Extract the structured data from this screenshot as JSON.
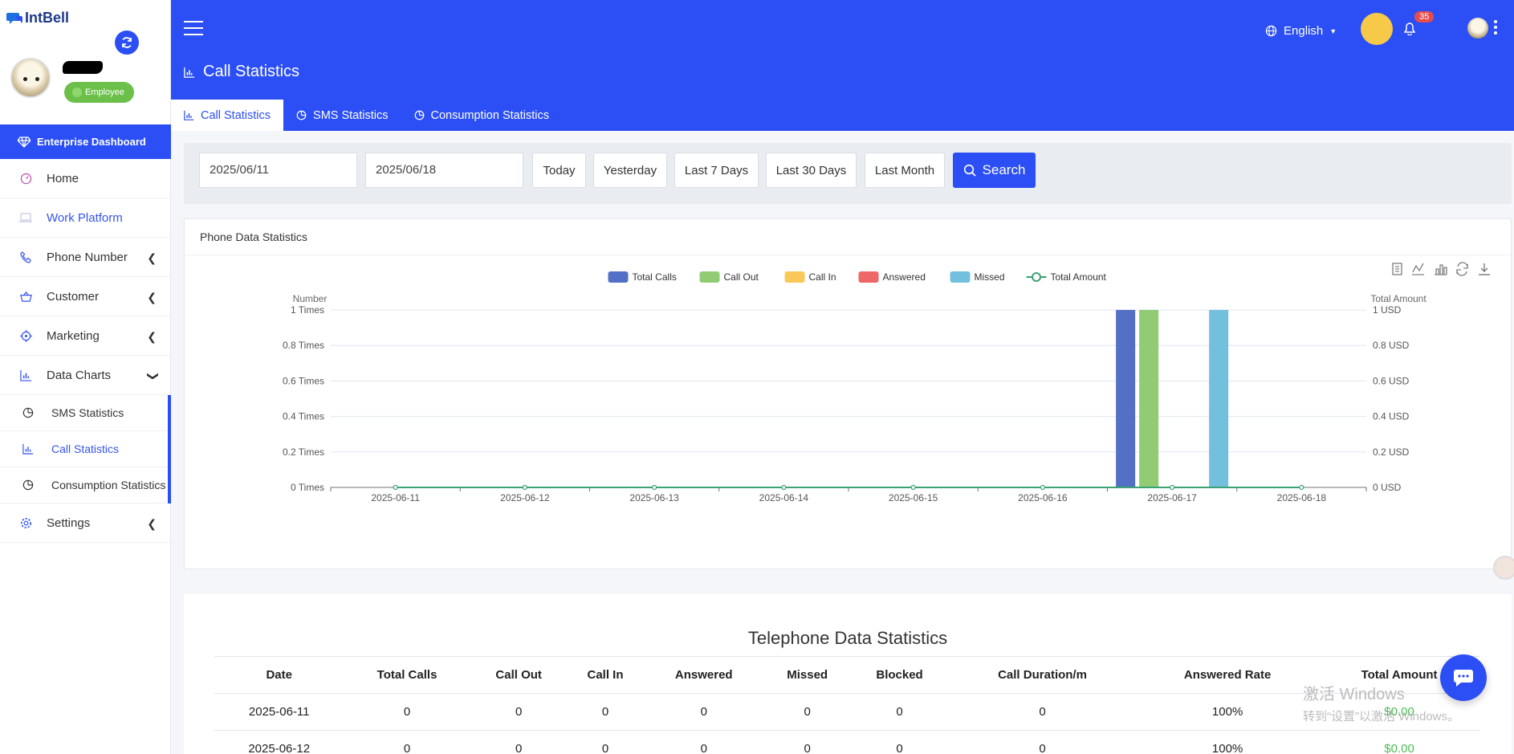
{
  "app": {
    "logo_text": "IntBell"
  },
  "user": {
    "role": "Employee"
  },
  "sidebar": {
    "enterprise_label": "Enterprise Dashboard",
    "items": [
      {
        "label": "Home"
      },
      {
        "label": "Work Platform"
      },
      {
        "label": "Phone Number"
      },
      {
        "label": "Customer"
      },
      {
        "label": "Marketing"
      },
      {
        "label": "Data Charts"
      },
      {
        "label": "Settings"
      }
    ],
    "sub_items": [
      {
        "label": "SMS Statistics"
      },
      {
        "label": "Call Statistics"
      },
      {
        "label": "Consumption Statistics"
      }
    ]
  },
  "header": {
    "page_title": "Call Statistics",
    "language": "English",
    "notification_count": "35",
    "tabs": [
      {
        "label": "Call Statistics"
      },
      {
        "label": "SMS Statistics"
      },
      {
        "label": "Consumption Statistics"
      }
    ]
  },
  "filter": {
    "start_date": "2025/06/11",
    "end_date": "2025/06/18",
    "quick": [
      "Today",
      "Yesterday",
      "Last 7 Days",
      "Last 30 Days",
      "Last Month"
    ],
    "search_label": "Search"
  },
  "chart_card": {
    "title": "Phone Data Statistics"
  },
  "chart_data": {
    "type": "bar",
    "categories": [
      "2025-06-11",
      "2025-06-12",
      "2025-06-13",
      "2025-06-14",
      "2025-06-15",
      "2025-06-16",
      "2025-06-17",
      "2025-06-18"
    ],
    "series": [
      {
        "name": "Total Calls",
        "type": "bar",
        "color": "#5470c6",
        "values": [
          0,
          0,
          0,
          0,
          0,
          0,
          1,
          0
        ]
      },
      {
        "name": "Call Out",
        "type": "bar",
        "color": "#91cc75",
        "values": [
          0,
          0,
          0,
          0,
          0,
          0,
          1,
          0
        ]
      },
      {
        "name": "Call In",
        "type": "bar",
        "color": "#fac858",
        "values": [
          0,
          0,
          0,
          0,
          0,
          0,
          0,
          0
        ]
      },
      {
        "name": "Answered",
        "type": "bar",
        "color": "#ee6666",
        "values": [
          0,
          0,
          0,
          0,
          0,
          0,
          0,
          0
        ]
      },
      {
        "name": "Missed",
        "type": "bar",
        "color": "#73c0de",
        "values": [
          0,
          0,
          0,
          0,
          0,
          0,
          1,
          0
        ]
      },
      {
        "name": "Total Amount",
        "type": "line",
        "color": "#3ba272",
        "values": [
          0,
          0,
          0,
          0,
          0,
          0,
          0,
          0
        ]
      }
    ],
    "ylabel": "Number",
    "y2label": "Total Amount",
    "yticks": [
      "0 Times",
      "0.2 Times",
      "0.4 Times",
      "0.6 Times",
      "0.8 Times",
      "1 Times"
    ],
    "y2ticks": [
      "0 USD",
      "0.2 USD",
      "0.4 USD",
      "0.6 USD",
      "0.8 USD",
      "1 USD"
    ],
    "ylim": [
      0,
      1
    ],
    "legend": "top-center"
  },
  "table": {
    "title": "Telephone Data Statistics",
    "headers": [
      "Date",
      "Total Calls",
      "Call Out",
      "Call In",
      "Answered",
      "Missed",
      "Blocked",
      "Call Duration/m",
      "Answered Rate",
      "Total Amount"
    ],
    "rows": [
      [
        "2025-06-11",
        "0",
        "0",
        "0",
        "0",
        "0",
        "0",
        "0",
        "100%",
        "$0.00"
      ],
      [
        "2025-06-12",
        "0",
        "0",
        "0",
        "0",
        "0",
        "0",
        "0",
        "100%",
        "$0.00"
      ]
    ]
  },
  "watermark": {
    "line1": "激活 Windows",
    "line2": "转到“设置”以激活 Windows。"
  }
}
